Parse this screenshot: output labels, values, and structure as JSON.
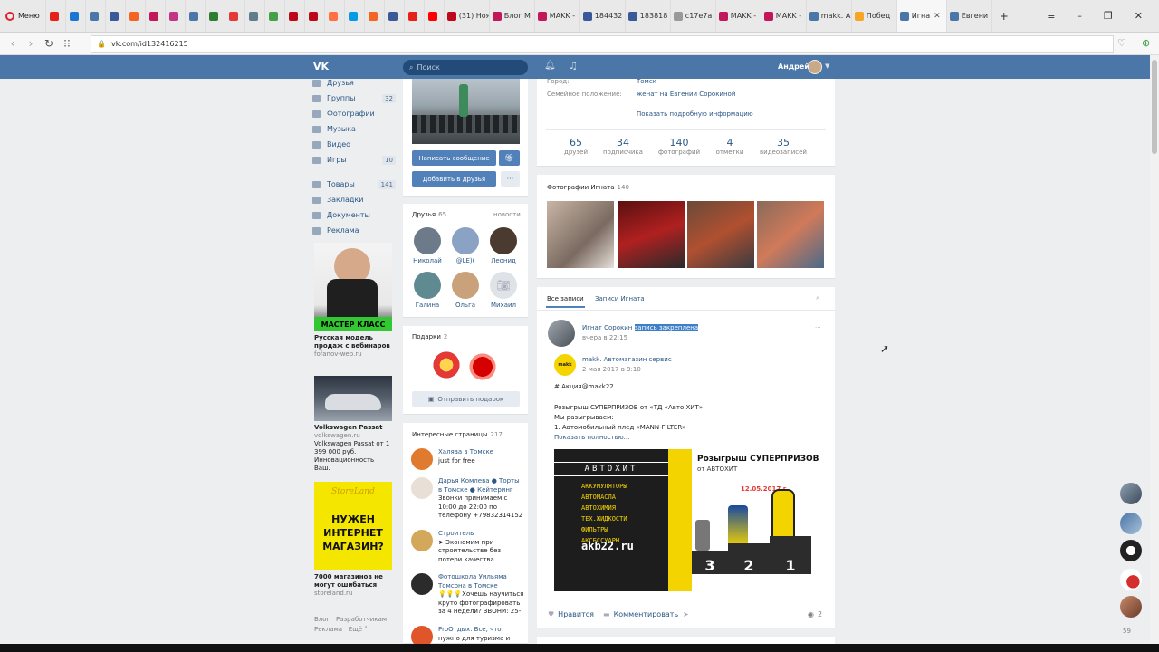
{
  "browser": {
    "menu_label": "Меню",
    "tabs": [
      {
        "type": "icon",
        "icon": "youtube-favicon",
        "color": "#e62117"
      },
      {
        "type": "icon",
        "icon": "generic-favicon",
        "color": "#1976d2"
      },
      {
        "type": "icon",
        "icon": "vk-favicon",
        "color": "#4a76a8"
      },
      {
        "type": "icon",
        "icon": "facebook-favicon",
        "color": "#3b5998"
      },
      {
        "type": "icon",
        "icon": "odnoklassniki-favicon",
        "color": "#f26522"
      },
      {
        "type": "icon",
        "icon": "makk-favicon",
        "color": "#c2185b"
      },
      {
        "type": "icon",
        "icon": "instagram-favicon",
        "color": "#c13584"
      },
      {
        "type": "icon",
        "icon": "vk-favicon",
        "color": "#4a76a8"
      },
      {
        "type": "icon",
        "icon": "generic-favicon",
        "color": "#2e7d32"
      },
      {
        "type": "icon",
        "icon": "generic-favicon",
        "color": "#e53935"
      },
      {
        "type": "icon",
        "icon": "generic-favicon",
        "color": "#607d8b"
      },
      {
        "type": "icon",
        "icon": "generic-favicon",
        "color": "#43a047"
      },
      {
        "type": "icon",
        "icon": "pinterest-favicon",
        "color": "#bd081c"
      },
      {
        "type": "icon",
        "icon": "pinterest-favicon",
        "color": "#bd081c"
      },
      {
        "type": "icon",
        "icon": "generic-favicon",
        "color": "#ff7043"
      },
      {
        "type": "icon",
        "icon": "generic-favicon",
        "color": "#039be5"
      },
      {
        "type": "icon",
        "icon": "odnoklassniki-favicon",
        "color": "#f26522"
      },
      {
        "type": "icon",
        "icon": "facebook-favicon",
        "color": "#3b5998"
      },
      {
        "type": "icon",
        "icon": "youtube-favicon",
        "color": "#e62117"
      },
      {
        "type": "icon",
        "icon": "yandex-favicon",
        "color": "#f00"
      },
      {
        "type": "text",
        "label": "(31) Ноя",
        "icon": "pinterest-favicon",
        "color": "#bd081c"
      },
      {
        "type": "text",
        "label": "Блог М",
        "icon": "makk-favicon",
        "color": "#c2185b"
      },
      {
        "type": "text",
        "label": "MAKK -",
        "icon": "makk-favicon",
        "color": "#c2185b"
      },
      {
        "type": "text",
        "label": "184432",
        "icon": "facebook-favicon",
        "color": "#3b5998"
      },
      {
        "type": "text",
        "label": "183818",
        "icon": "facebook-favicon",
        "color": "#3b5998"
      },
      {
        "type": "text",
        "label": "c17e7a",
        "icon": "generic-favicon",
        "color": "#999"
      },
      {
        "type": "text",
        "label": "MAKK -",
        "icon": "makk-favicon",
        "color": "#c2185b"
      },
      {
        "type": "text",
        "label": "MAKK -",
        "icon": "makk-favicon",
        "color": "#c2185b"
      },
      {
        "type": "text",
        "label": "makk. А",
        "icon": "vk-favicon",
        "color": "#4a76a8"
      },
      {
        "type": "text",
        "label": "Побед",
        "icon": "generic-favicon",
        "color": "#f5a623"
      },
      {
        "type": "active",
        "label": "Игна",
        "icon": "vk-favicon",
        "color": "#4a76a8"
      },
      {
        "type": "text",
        "label": "Евгени",
        "icon": "vk-favicon",
        "color": "#4a76a8"
      }
    ],
    "new_tab": "+",
    "url": "vk.com/id132416215"
  },
  "vk_header": {
    "logo": "VK",
    "search_placeholder": "Поиск",
    "user_name": "Андрей"
  },
  "left_menu": [
    {
      "label": "Друзья",
      "count": ""
    },
    {
      "label": "Группы",
      "count": "32"
    },
    {
      "label": "Фотографии",
      "count": ""
    },
    {
      "label": "Музыка",
      "count": ""
    },
    {
      "label": "Видео",
      "count": ""
    },
    {
      "label": "Игры",
      "count": "10"
    },
    {
      "label": "Товары",
      "count": "141"
    },
    {
      "label": "Закладки",
      "count": ""
    },
    {
      "label": "Документы",
      "count": ""
    },
    {
      "label": "Реклама",
      "count": ""
    }
  ],
  "ads": [
    {
      "banner": "МАСТЕР КЛАСС",
      "title": "Русская модель продаж с вебинаров",
      "site": "fofanov-web.ru",
      "text": ""
    },
    {
      "banner": "",
      "title": "Volkswagen Passat",
      "site": "volkswagen.ru",
      "text": "Volkswagen Passat от 1 399 000 руб. Инновационность Ваш."
    },
    {
      "banner": "НУЖЕН ИНТЕРНЕТ МАГАЗИН?",
      "brand": "StoreLand",
      "title": "7000 магазинов не могут ошибаться",
      "site": "storeland.ru",
      "text": ""
    }
  ],
  "footer": {
    "blog": "Блог",
    "dev": "Разработчикам",
    "ads": "Реклама",
    "more": "Ещё ˅"
  },
  "profile": {
    "btn_message": "Написать сообщение",
    "btn_add": "Добавить в друзья",
    "btn_more": "···",
    "friends_title": "Друзья",
    "friends_count": "65",
    "friends_news": "новости",
    "friends": [
      {
        "name": "Николай",
        "color": "#6c7a89"
      },
      {
        "name": "@LE)(",
        "color": "#8aa3c4"
      },
      {
        "name": "Леонид",
        "color": "#4b3a30"
      },
      {
        "name": "Галина",
        "color": "#5f8a92"
      },
      {
        "name": "Ольга",
        "color": "#c9a17a"
      },
      {
        "name": "Михаил",
        "color": "#dfe3e8"
      }
    ],
    "gifts_title": "Подарки",
    "gifts_count": "2",
    "send_gift": "Отправить подарок",
    "pages_title": "Интересные страницы",
    "pages_count": "217",
    "pages": [
      {
        "name": "Халява в Томске",
        "desc": "just for free",
        "color": "#e07a2e"
      },
      {
        "name": "Дарья Комлева ● Торты в Томске ● Кейтеринг",
        "desc": "Звонки принимаем с 10:00 до 22:00 по телефону +79832314152",
        "color": "#e8e0d6"
      },
      {
        "name": "Строитель",
        "desc": "➤ Экономим при строительстве без потери качества",
        "color": "#d4a85a"
      },
      {
        "name": "Фотошкола Уильяма Томсона в Томске",
        "desc": "💡💡💡Хочешь научиться круто фотографировать за 4 недели? ЗВОНИ: 25-",
        "color": "#2b2b2b"
      },
      {
        "name": "ProОтдых. Все, что",
        "desc": "нужно для туризма и",
        "color": "#e0552a"
      }
    ]
  },
  "info": {
    "city_label": "Город:",
    "city": "Томск",
    "family_label": "Семейное положение:",
    "family": "женат на Евгении Сорокиной",
    "show_more": "Показать подробную информацию"
  },
  "stats": [
    {
      "value": "65",
      "label": "друзей"
    },
    {
      "value": "34",
      "label": "подписчика"
    },
    {
      "value": "140",
      "label": "фотографий"
    },
    {
      "value": "4",
      "label": "отметки"
    },
    {
      "value": "35",
      "label": "видеозаписей"
    }
  ],
  "photos": {
    "title": "Фотографии Игната",
    "count": "140"
  },
  "wall": {
    "tab_all": "Все записи",
    "tab_own": "Записи Игната",
    "author": "Игнат Сорокин",
    "pinned": "запись закреплена",
    "time": "вчера в 22:15",
    "repost_author": "makk. Автомагазин сервис",
    "repost_time": "2 мая 2017 в 9:10",
    "text1": "# Акция@makk22",
    "text2": "Розыгрыш СУПЕРПРИЗОВ от «ТД «Авто ХИТ»!",
    "text3": "Мы разыгрываем:",
    "text4": "1. Автомобильный плед «MANN-FILTER»",
    "show_full": "Показать полностью...",
    "banner_left_brand": "АВТОХИТ",
    "banner_left_lines": [
      "АККУМУЛЯТОРЫ",
      "АВТОМАСЛА",
      "АВТОХИМИЯ",
      "ТЕХ.ЖИДКОСТИ",
      "ФИЛЬТРЫ",
      "АКСЕССУАРЫ"
    ],
    "banner_site": "akb22.ru",
    "banner_title": "Розыгрыш СУПЕРПРИЗОВ",
    "banner_from": "от АВТОХИТ",
    "banner_date": "12.05.2017 г.",
    "podium": [
      "3",
      "2",
      "1"
    ],
    "like": "Нравится",
    "comment": "Комментировать",
    "views": "2"
  },
  "side_count": "59"
}
